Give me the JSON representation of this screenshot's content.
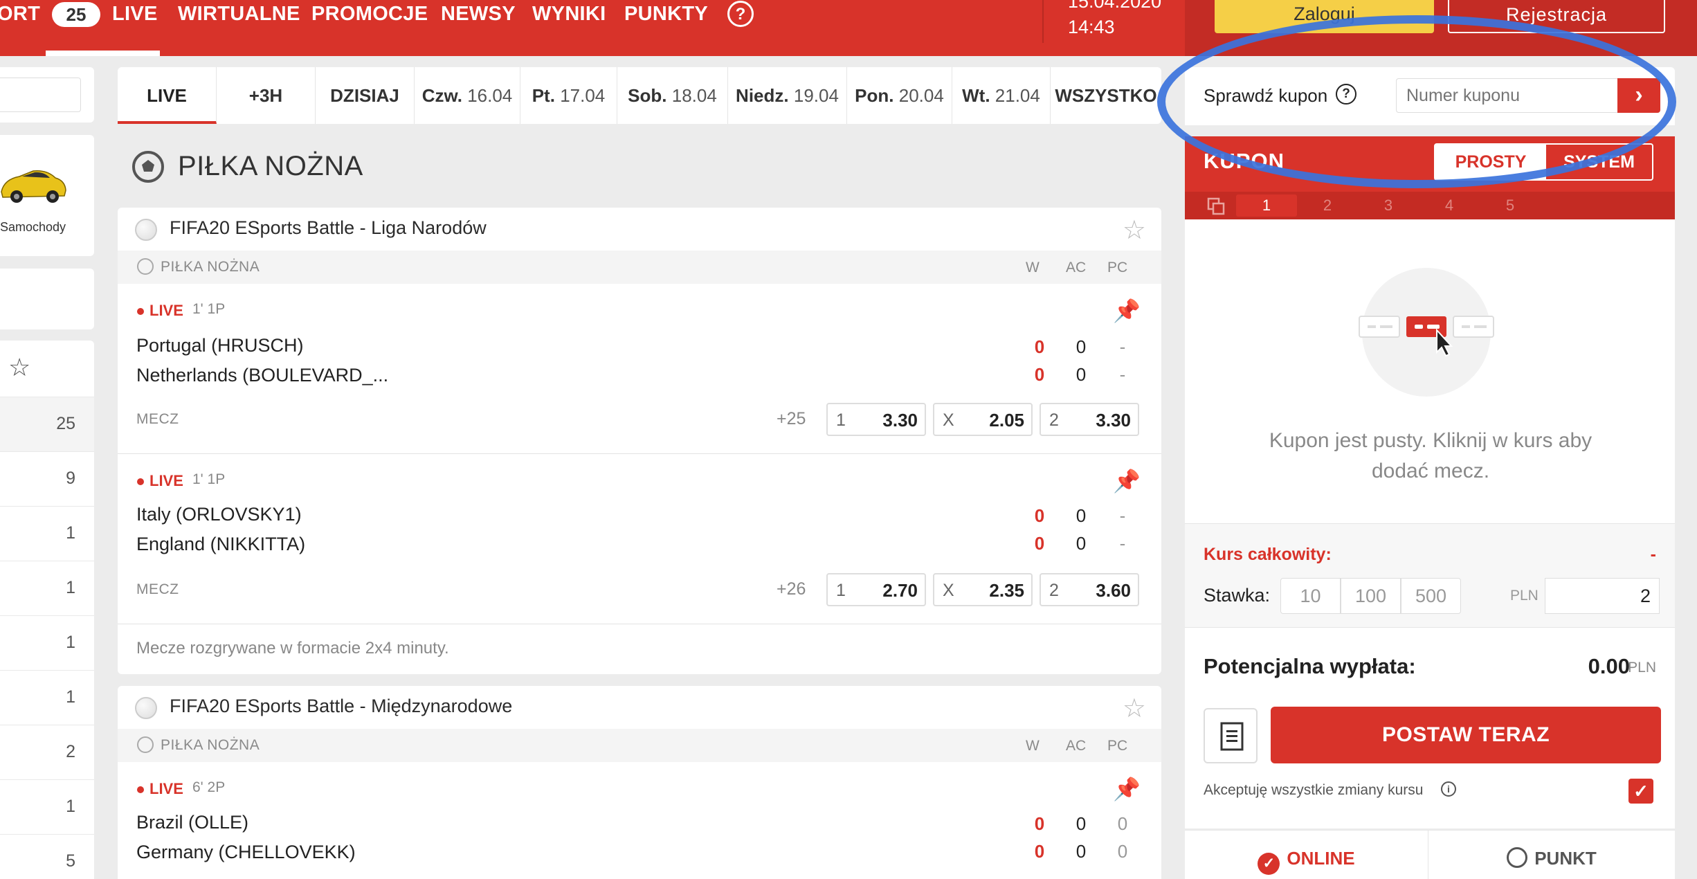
{
  "nav": {
    "items": [
      "ORT",
      "LIVE",
      "WIRTUALNE",
      "PROMOCJE",
      "NEWSY",
      "WYNIKI",
      "PUNKTY"
    ],
    "badge": "25",
    "help": "?",
    "date": "15.04.2020",
    "time": "14:43",
    "login": "Zaloguj",
    "register": "Rejestracja"
  },
  "left": {
    "car_label": "Samochody",
    "counts": [
      "25",
      "9",
      "1",
      "1",
      "1",
      "1",
      "2",
      "1",
      "5"
    ]
  },
  "tabs": [
    {
      "day": "LIVE",
      "date": ""
    },
    {
      "day": "+3H",
      "date": ""
    },
    {
      "day": "DZISIAJ",
      "date": ""
    },
    {
      "day": "Czw.",
      "date": "16.04"
    },
    {
      "day": "Pt.",
      "date": "17.04"
    },
    {
      "day": "Sob.",
      "date": "18.04"
    },
    {
      "day": "Niedz.",
      "date": "19.04"
    },
    {
      "day": "Pon.",
      "date": "20.04"
    },
    {
      "day": "Wt.",
      "date": "21.04"
    },
    {
      "day": "WSZYSTKO",
      "date": ""
    }
  ],
  "section_title": "PIŁKA NOŻNA",
  "leagues": [
    {
      "name": "FIFA20 ESports Battle - Liga Narodów",
      "sport": "PIŁKA NOŻNA",
      "cols": [
        "W",
        "AC",
        "PC"
      ],
      "matches": [
        {
          "live": "LIVE",
          "time": "1' 1P",
          "home": "Portugal (HRUSCH)",
          "away": "Netherlands (BOULEVARD_...",
          "home_scores": [
            "0",
            "0",
            "-"
          ],
          "away_scores": [
            "0",
            "0",
            "-"
          ],
          "market": "MECZ",
          "more": "+25",
          "odds": [
            {
              "label": "1",
              "value": "3.30"
            },
            {
              "label": "X",
              "value": "2.05"
            },
            {
              "label": "2",
              "value": "3.30"
            }
          ]
        },
        {
          "live": "LIVE",
          "time": "1' 1P",
          "home": "Italy (ORLOVSKY1)",
          "away": "England (NIKKITTA)",
          "home_scores": [
            "0",
            "0",
            "-"
          ],
          "away_scores": [
            "0",
            "0",
            "-"
          ],
          "market": "MECZ",
          "more": "+26",
          "odds": [
            {
              "label": "1",
              "value": "2.70"
            },
            {
              "label": "X",
              "value": "2.35"
            },
            {
              "label": "2",
              "value": "3.60"
            }
          ]
        }
      ],
      "note": "Mecze rozgrywane w formacie 2x4 minuty."
    },
    {
      "name": "FIFA20 ESports Battle - Międzynarodowe",
      "sport": "PIŁKA NOŻNA",
      "cols": [
        "W",
        "AC",
        "PC"
      ],
      "matches": [
        {
          "live": "LIVE",
          "time": "6' 2P",
          "home": "Brazil (OLLE)",
          "away": "Germany (CHELLOVEKK)",
          "home_scores": [
            "0",
            "0",
            "0"
          ],
          "away_scores": [
            "0",
            "0",
            "0"
          ]
        }
      ]
    }
  ],
  "coupon": {
    "check_label": "Sprawdź kupon",
    "check_placeholder": "Numer kuponu",
    "title": "KUPON",
    "mode_simple": "PROSTY",
    "mode_system": "SYSTEM",
    "tabs": [
      "1",
      "2",
      "3",
      "4",
      "5"
    ],
    "empty_text": "Kupon jest pusty. Kliknij w kurs aby dodać mecz.",
    "total_label": "Kurs całkowity:",
    "total_value": "-",
    "stake_label": "Stawka:",
    "stake_chips": [
      "10",
      "100",
      "500"
    ],
    "currency": "PLN",
    "stake_value": "2",
    "payout_label": "Potencjalna wypłata:",
    "payout_value": "0.00",
    "place_bet": "POSTAW TERAZ",
    "accept_label": "Akceptuję wszystkie zmiany kursu",
    "online": "ONLINE",
    "punkt": "PUNKT"
  },
  "colors": {
    "brand_red": "#d8332a",
    "login_yellow": "#f5cf47",
    "highlight_blue": "#3b73dc"
  }
}
